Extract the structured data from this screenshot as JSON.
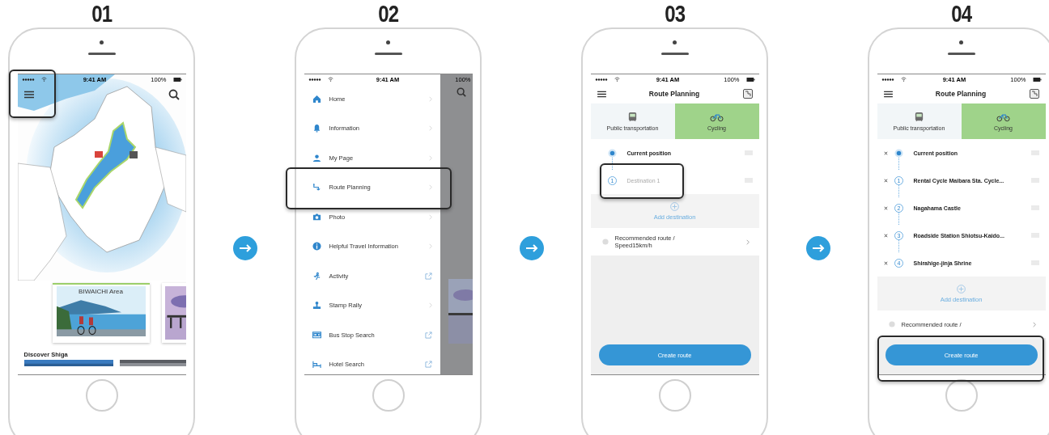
{
  "steps": [
    {
      "number": "01",
      "screen": {
        "kind": "map",
        "status": {
          "time": "9:41 AM",
          "battery": "100%"
        },
        "menu_button_highlighted": true,
        "card_title": "BIWAICHI Area",
        "section_title": "Discover Shiga"
      }
    },
    {
      "number": "02",
      "screen": {
        "kind": "menu",
        "status": {
          "time": "9:41 AM",
          "battery": "100%"
        },
        "items": [
          {
            "kind": "page",
            "label": "Home",
            "highlighted": false
          },
          {
            "kind": "page",
            "label": "Information",
            "highlighted": false
          },
          {
            "kind": "page",
            "label": "My Page",
            "highlighted": false
          },
          {
            "kind": "page",
            "label": "Route Planning",
            "highlighted": true
          },
          {
            "kind": "page",
            "label": "Photo",
            "highlighted": false
          },
          {
            "kind": "page",
            "label": "Helpful Travel Information",
            "highlighted": false
          },
          {
            "kind": "external",
            "label": "Activity",
            "highlighted": false
          },
          {
            "kind": "page",
            "label": "Stamp Rally",
            "highlighted": false
          },
          {
            "kind": "external",
            "label": "Bus Stop Search",
            "highlighted": false
          },
          {
            "kind": "external",
            "label": "Hotel Search",
            "highlighted": false
          }
        ]
      }
    },
    {
      "number": "03",
      "screen": {
        "kind": "route",
        "status": {
          "time": "9:41 AM",
          "battery": "100%"
        },
        "title": "Route Planning",
        "tabs": [
          {
            "label": "Public transportation",
            "selected": false
          },
          {
            "label": "Cycling",
            "selected": true
          }
        ],
        "stops": [
          {
            "kind": "current",
            "label": "Current position",
            "removable": false,
            "highlighted": false
          },
          {
            "kind": "destination",
            "number": "1",
            "placeholder": "Destination 1",
            "removable": false,
            "highlighted": true
          }
        ],
        "add_label": "Add destination",
        "route_option": "Recommended route / Speed15km/h",
        "create_button": {
          "label": "Create route",
          "highlighted": false
        }
      }
    },
    {
      "number": "04",
      "screen": {
        "kind": "route",
        "status": {
          "time": "9:41 AM",
          "battery": "100%"
        },
        "title": "Route Planning",
        "tabs": [
          {
            "label": "Public transportation",
            "selected": false
          },
          {
            "label": "Cycling",
            "selected": true
          }
        ],
        "stops": [
          {
            "kind": "current",
            "label": "Current position",
            "removable": true,
            "highlighted": false
          },
          {
            "kind": "destination",
            "number": "1",
            "label": "Rental Cycle Maibara Sta. Cycle...",
            "removable": true,
            "highlighted": false
          },
          {
            "kind": "destination",
            "number": "2",
            "label": "Nagahama Castle",
            "removable": true,
            "highlighted": false
          },
          {
            "kind": "destination",
            "number": "3",
            "label": "Roadside Station Shiotsu-Kaido...",
            "removable": true,
            "highlighted": false
          },
          {
            "kind": "destination",
            "number": "4",
            "label": "Shirahige-jinja Shrine",
            "removable": true,
            "highlighted": false
          }
        ],
        "add_label": "Add destination",
        "route_option": "Recommended route /",
        "create_button": {
          "label": "Create route",
          "highlighted": true
        }
      }
    }
  ]
}
